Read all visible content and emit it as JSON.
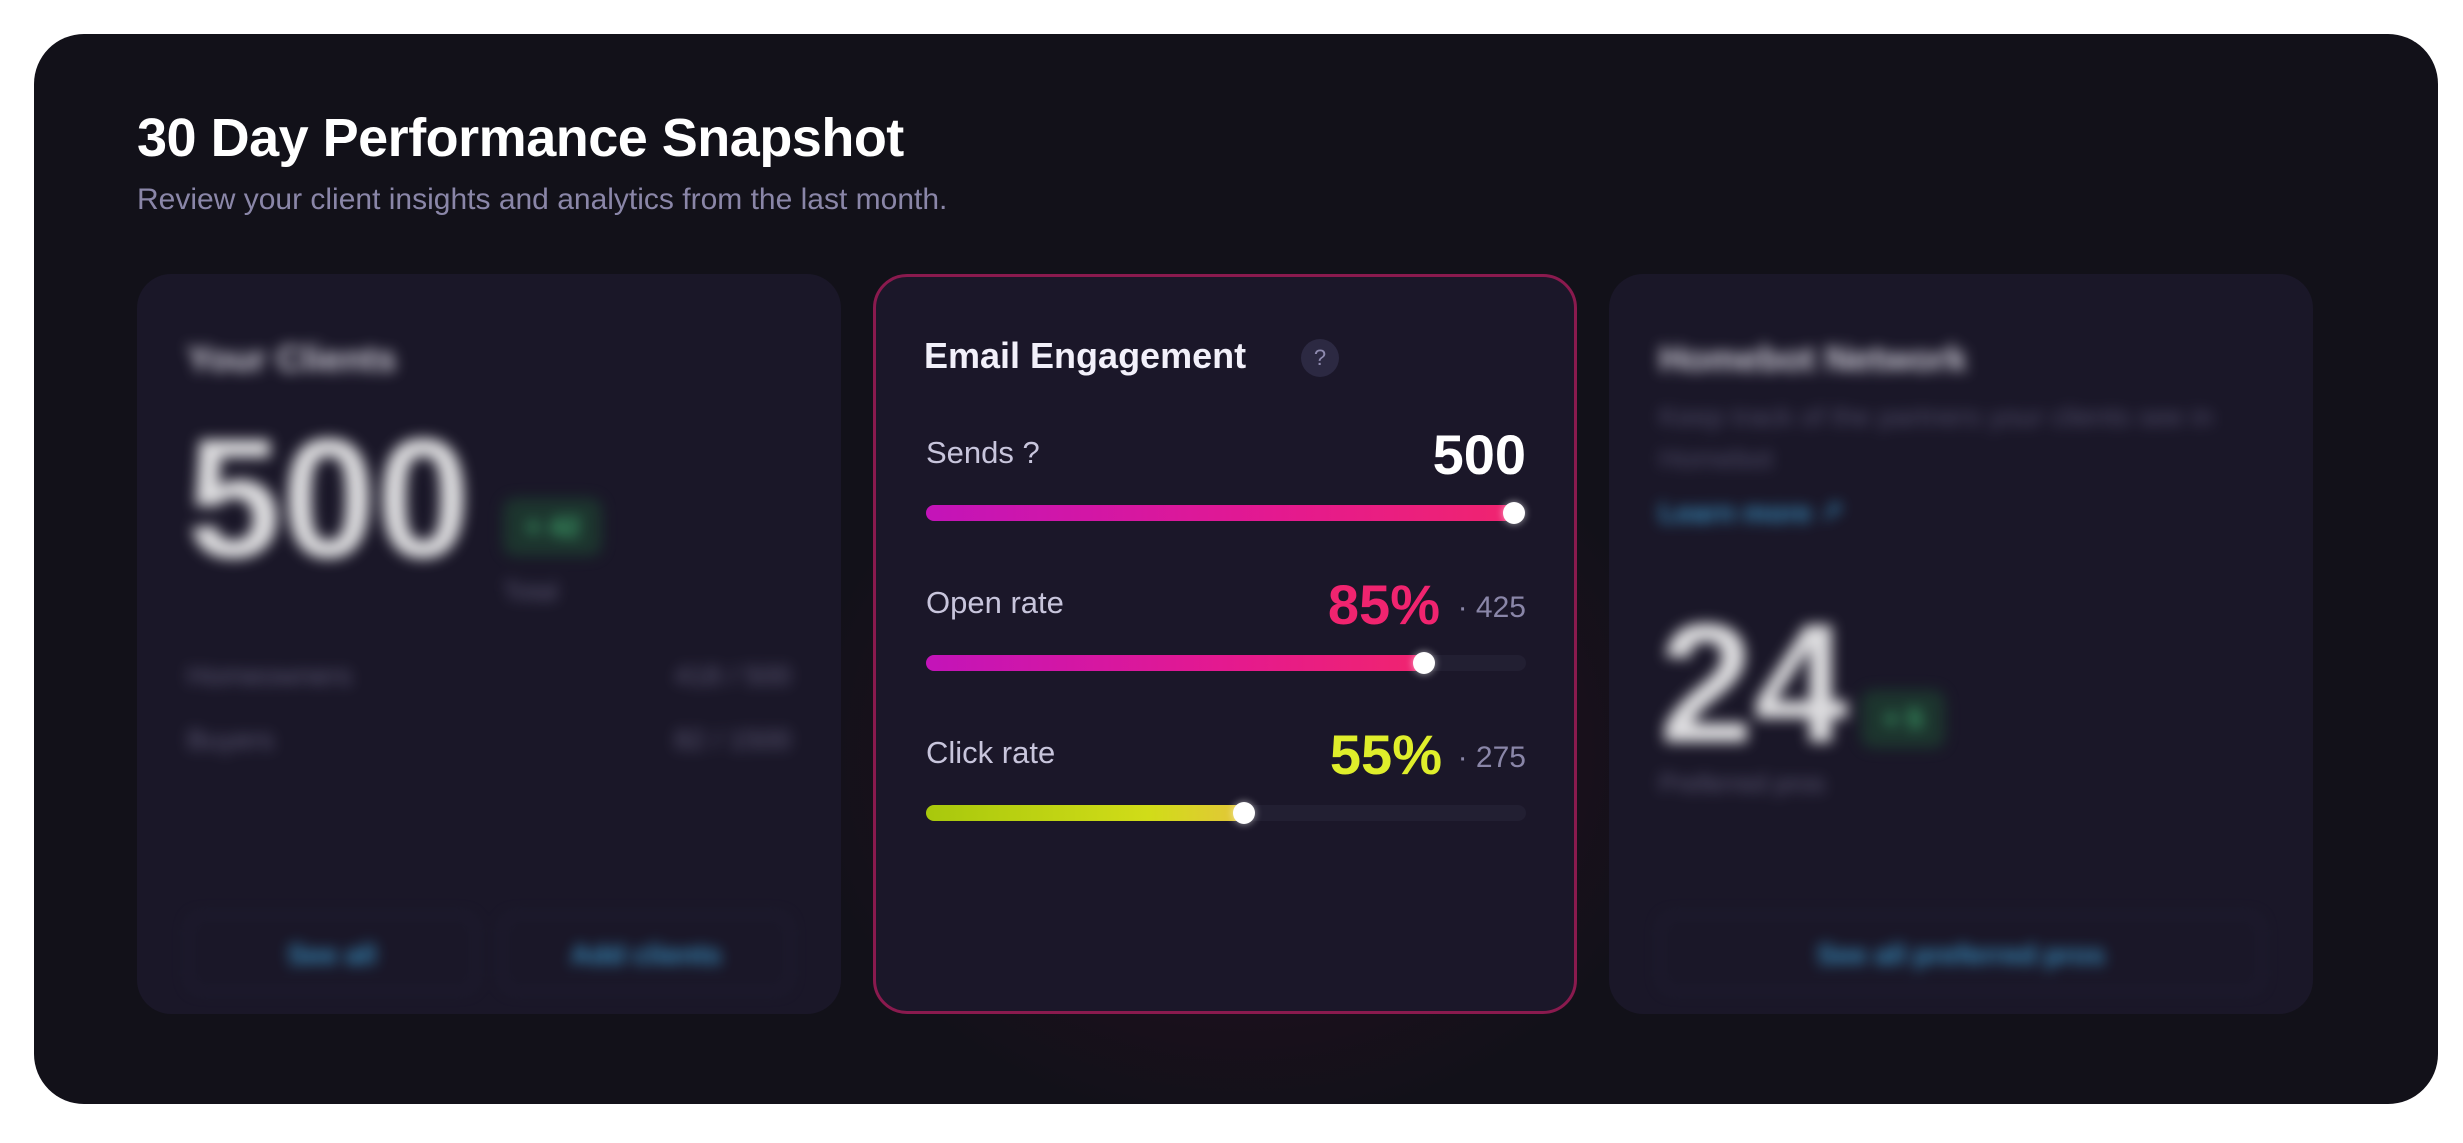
{
  "header": {
    "title": "30 Day Performance Snapshot",
    "subtitle": "Review your client insights and analytics from the last month."
  },
  "clients_card": {
    "title": "Your Clients",
    "total": "500",
    "delta": "+ 42",
    "total_label": "Total",
    "rows": [
      {
        "label": "Homeowners",
        "value": "418 / 500"
      },
      {
        "label": "Buyers",
        "value": "82 / 1500"
      }
    ],
    "see_all_label": "See all",
    "add_clients_label": "Add clients"
  },
  "email_card": {
    "title": "Email Engagement",
    "help_glyph": "?",
    "sends": {
      "label": "Sends ?",
      "value": "500",
      "progress": 0.98
    },
    "open_rate": {
      "label": "Open rate",
      "value": "85%",
      "count": "· 425",
      "progress": 0.83
    },
    "click_rate": {
      "label": "Click rate",
      "value": "55%",
      "count": "· 275",
      "progress": 0.53
    }
  },
  "network_card": {
    "title": "Homebot Network",
    "description": "Keep track of the partners your clients see in Homebot",
    "learn_more_label": "Learn more ↗",
    "count": "24",
    "delta": "+ 5",
    "count_label": "Preferred pros",
    "see_all_label": "See all preferred pros"
  },
  "colors": {
    "background": "#121119",
    "card": "#1a1728",
    "accent_pink": "#f0246f",
    "accent_lime": "#dfee2b",
    "link_blue": "#3fa6dc",
    "success_green": "#46c27a"
  }
}
